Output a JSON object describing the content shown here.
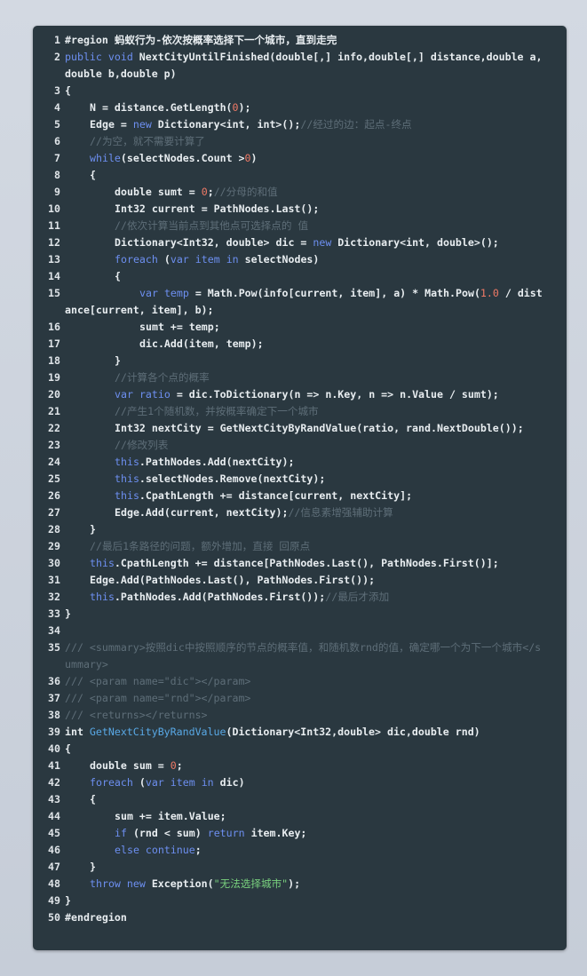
{
  "code": {
    "lines": [
      {
        "n": "1",
        "i": 0,
        "t": [
          [
            "pl",
            "#region 蚂蚁行为-依次按概率选择下一个城市，直到走完"
          ]
        ]
      },
      {
        "n": "2",
        "i": 0,
        "t": [
          [
            "kw",
            "public"
          ],
          [
            "pl",
            " "
          ],
          [
            "kw",
            "void"
          ],
          [
            "pl",
            " NextCityUntilFinished(double[,] info,double[,] distance,double a,double b,double p)"
          ]
        ]
      },
      {
        "n": "3",
        "i": 0,
        "t": [
          [
            "pl",
            "{"
          ]
        ]
      },
      {
        "n": "4",
        "i": 1,
        "t": [
          [
            "pl",
            "N = distance.GetLength("
          ],
          [
            "num",
            "0"
          ],
          [
            "pl",
            ");"
          ]
        ]
      },
      {
        "n": "5",
        "i": 1,
        "t": [
          [
            "pl",
            "Edge = "
          ],
          [
            "kw",
            "new"
          ],
          [
            "pl",
            " Dictionary<int, int>();"
          ],
          [
            "cm",
            "//经过的边：起点-终点"
          ]
        ]
      },
      {
        "n": "6",
        "i": 1,
        "t": [
          [
            "cm",
            "//为空，就不需要计算了"
          ]
        ]
      },
      {
        "n": "7",
        "i": 1,
        "t": [
          [
            "kw",
            "while"
          ],
          [
            "pl",
            "(selectNodes.Count >"
          ],
          [
            "num",
            "0"
          ],
          [
            "pl",
            ")"
          ]
        ]
      },
      {
        "n": "8",
        "i": 1,
        "t": [
          [
            "pl",
            "{"
          ]
        ]
      },
      {
        "n": "9",
        "i": 2,
        "t": [
          [
            "pl",
            "double sumt = "
          ],
          [
            "num",
            "0"
          ],
          [
            "pl",
            ";"
          ],
          [
            "cm",
            "//分母的和值"
          ]
        ]
      },
      {
        "n": "10",
        "i": 2,
        "t": [
          [
            "pl",
            "Int32 current = PathNodes.Last();"
          ]
        ]
      },
      {
        "n": "11",
        "i": 2,
        "t": [
          [
            "cm",
            "//依次计算当前点到其他点可选择点的 值"
          ]
        ]
      },
      {
        "n": "12",
        "i": 2,
        "t": [
          [
            "pl",
            "Dictionary<Int32, double> dic = "
          ],
          [
            "kw",
            "new"
          ],
          [
            "pl",
            " Dictionary<int, double>();"
          ]
        ]
      },
      {
        "n": "13",
        "i": 2,
        "t": [
          [
            "kw",
            "foreach"
          ],
          [
            "pl",
            " ("
          ],
          [
            "kw",
            "var"
          ],
          [
            "pl",
            " "
          ],
          [
            "kw",
            "item"
          ],
          [
            "pl",
            " "
          ],
          [
            "kw",
            "in"
          ],
          [
            "pl",
            " selectNodes)"
          ]
        ]
      },
      {
        "n": "14",
        "i": 2,
        "t": [
          [
            "pl",
            "{"
          ]
        ]
      },
      {
        "n": "15",
        "i": 3,
        "t": [
          [
            "kw",
            "var"
          ],
          [
            "pl",
            " "
          ],
          [
            "kw",
            "temp"
          ],
          [
            "pl",
            " = Math.Pow(info[current, item], a) * Math.Pow("
          ],
          [
            "num",
            "1.0"
          ],
          [
            "pl",
            " / distance[current, item], b);"
          ]
        ]
      },
      {
        "n": "16",
        "i": 3,
        "t": [
          [
            "pl",
            "sumt += temp;"
          ]
        ]
      },
      {
        "n": "17",
        "i": 3,
        "t": [
          [
            "pl",
            "dic.Add(item, temp);"
          ]
        ]
      },
      {
        "n": "18",
        "i": 2,
        "t": [
          [
            "pl",
            "}"
          ]
        ]
      },
      {
        "n": "19",
        "i": 2,
        "t": [
          [
            "cm",
            "//计算各个点的概率"
          ]
        ]
      },
      {
        "n": "20",
        "i": 2,
        "t": [
          [
            "kw",
            "var"
          ],
          [
            "pl",
            " "
          ],
          [
            "kw",
            "ratio"
          ],
          [
            "pl",
            " = dic.ToDictionary(n => n.Key, n => n.Value / sumt);"
          ]
        ]
      },
      {
        "n": "21",
        "i": 2,
        "t": [
          [
            "cm",
            "//产生1个随机数，并按概率确定下一个城市"
          ]
        ]
      },
      {
        "n": "22",
        "i": 2,
        "t": [
          [
            "pl",
            "Int32 nextCity = GetNextCityByRandValue(ratio, rand.NextDouble());"
          ]
        ]
      },
      {
        "n": "23",
        "i": 2,
        "t": [
          [
            "cm",
            "//修改列表"
          ]
        ]
      },
      {
        "n": "24",
        "i": 2,
        "t": [
          [
            "kw",
            "this"
          ],
          [
            "pl",
            ".PathNodes.Add(nextCity);"
          ]
        ]
      },
      {
        "n": "25",
        "i": 2,
        "t": [
          [
            "kw",
            "this"
          ],
          [
            "pl",
            ".selectNodes.Remove(nextCity);"
          ]
        ]
      },
      {
        "n": "26",
        "i": 2,
        "t": [
          [
            "kw",
            "this"
          ],
          [
            "pl",
            ".CpathLength += distance[current, nextCity];"
          ]
        ]
      },
      {
        "n": "27",
        "i": 2,
        "t": [
          [
            "pl",
            "Edge.Add(current, nextCity);"
          ],
          [
            "cm",
            "//信息素增强辅助计算"
          ]
        ]
      },
      {
        "n": "28",
        "i": 1,
        "t": [
          [
            "pl",
            "}"
          ]
        ]
      },
      {
        "n": "29",
        "i": 1,
        "t": [
          [
            "cm",
            "//最后1条路径的问题，额外增加，直接 回原点"
          ]
        ]
      },
      {
        "n": "30",
        "i": 1,
        "t": [
          [
            "kw",
            "this"
          ],
          [
            "pl",
            ".CpathLength += distance[PathNodes.Last(), PathNodes.First()];"
          ]
        ]
      },
      {
        "n": "31",
        "i": 1,
        "t": [
          [
            "pl",
            "Edge.Add(PathNodes.Last(), PathNodes.First());"
          ]
        ]
      },
      {
        "n": "32",
        "i": 1,
        "t": [
          [
            "kw",
            "this"
          ],
          [
            "pl",
            ".PathNodes.Add(PathNodes.First());"
          ],
          [
            "cm",
            "//最后才添加"
          ]
        ]
      },
      {
        "n": "33",
        "i": 0,
        "t": [
          [
            "pl",
            "}"
          ]
        ]
      },
      {
        "n": "34",
        "i": 0,
        "t": [
          [
            "pl",
            ""
          ]
        ]
      },
      {
        "n": "35",
        "i": 0,
        "t": [
          [
            "cm",
            "/// <summary>按照dic中按照顺序的节点的概率值，和随机数rnd的值，确定哪一个为下一个城市</summary>"
          ]
        ]
      },
      {
        "n": "36",
        "i": 0,
        "t": [
          [
            "cm",
            "/// <param name=\"dic\"></param>"
          ]
        ]
      },
      {
        "n": "37",
        "i": 0,
        "t": [
          [
            "cm",
            "/// <param name=\"rnd\"></param>"
          ]
        ]
      },
      {
        "n": "38",
        "i": 0,
        "t": [
          [
            "cm",
            "/// <returns></returns>"
          ]
        ]
      },
      {
        "n": "39",
        "i": 0,
        "t": [
          [
            "pl",
            "int "
          ],
          [
            "fn",
            "GetNextCityByRandValue"
          ],
          [
            "pl",
            "(Dictionary<Int32,double> dic,double rnd)"
          ]
        ]
      },
      {
        "n": "40",
        "i": 0,
        "t": [
          [
            "pl",
            "{"
          ]
        ]
      },
      {
        "n": "41",
        "i": 1,
        "t": [
          [
            "pl",
            "double sum = "
          ],
          [
            "num",
            "0"
          ],
          [
            "pl",
            ";"
          ]
        ]
      },
      {
        "n": "42",
        "i": 1,
        "t": [
          [
            "kw",
            "foreach"
          ],
          [
            "pl",
            " ("
          ],
          [
            "kw",
            "var"
          ],
          [
            "pl",
            " "
          ],
          [
            "kw",
            "item"
          ],
          [
            "pl",
            " "
          ],
          [
            "kw",
            "in"
          ],
          [
            "pl",
            " dic)"
          ]
        ]
      },
      {
        "n": "43",
        "i": 1,
        "t": [
          [
            "pl",
            "{"
          ]
        ]
      },
      {
        "n": "44",
        "i": 2,
        "t": [
          [
            "pl",
            "sum += item.Value;"
          ]
        ]
      },
      {
        "n": "45",
        "i": 2,
        "t": [
          [
            "kw",
            "if"
          ],
          [
            "pl",
            " (rnd < sum) "
          ],
          [
            "kw",
            "return"
          ],
          [
            "pl",
            " item.Key;"
          ]
        ]
      },
      {
        "n": "46",
        "i": 2,
        "t": [
          [
            "kw",
            "else"
          ],
          [
            "pl",
            " "
          ],
          [
            "kw",
            "continue"
          ],
          [
            "pl",
            ";"
          ]
        ]
      },
      {
        "n": "47",
        "i": 1,
        "t": [
          [
            "pl",
            "}"
          ]
        ]
      },
      {
        "n": "48",
        "i": 1,
        "t": [
          [
            "kw",
            "throw"
          ],
          [
            "pl",
            " "
          ],
          [
            "kw",
            "new"
          ],
          [
            "pl",
            " Exception("
          ],
          [
            "str",
            "\"无法选择城市\""
          ],
          [
            "pl",
            ");"
          ]
        ]
      },
      {
        "n": "49",
        "i": 0,
        "t": [
          [
            "pl",
            "}"
          ]
        ]
      },
      {
        "n": "50",
        "i": 0,
        "t": [
          [
            "pl",
            "#endregion"
          ]
        ]
      }
    ]
  }
}
